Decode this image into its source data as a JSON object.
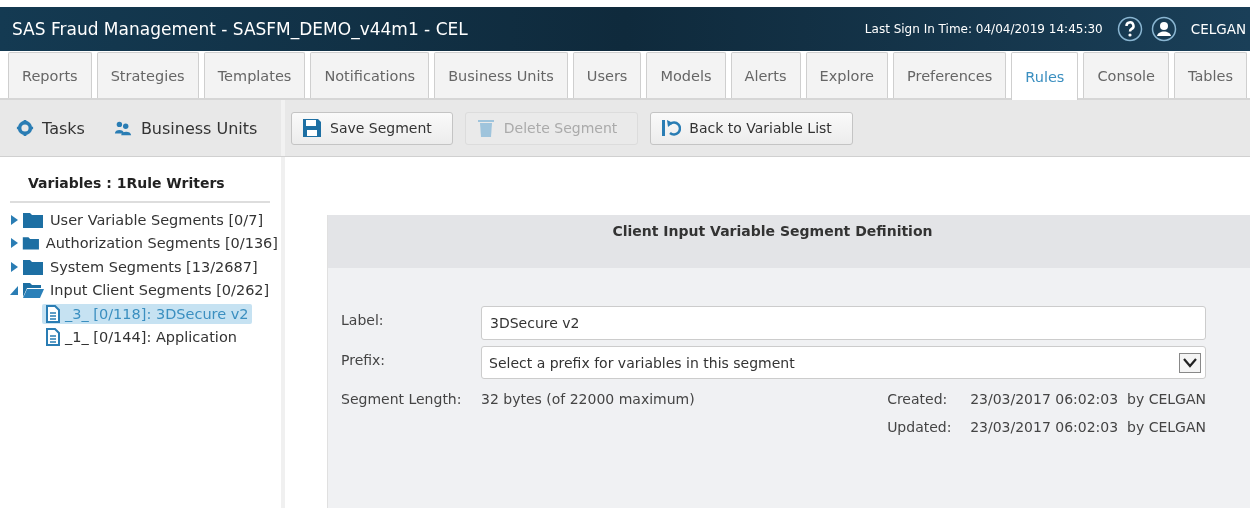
{
  "header": {
    "title": "SAS Fraud Management - SASFM_DEMO_v44m1 - CEL",
    "last_sign_in": "Last Sign In Time: 04/04/2019 14:45:30",
    "user": "CELGAN"
  },
  "tabs": [
    {
      "label": "Reports",
      "selected": false
    },
    {
      "label": "Strategies",
      "selected": false
    },
    {
      "label": "Templates",
      "selected": false
    },
    {
      "label": "Notifications",
      "selected": false
    },
    {
      "label": "Business Units",
      "selected": false
    },
    {
      "label": "Users",
      "selected": false
    },
    {
      "label": "Models",
      "selected": false
    },
    {
      "label": "Alerts",
      "selected": false
    },
    {
      "label": "Explore",
      "selected": false
    },
    {
      "label": "Preferences",
      "selected": false
    },
    {
      "label": "Rules",
      "selected": true
    },
    {
      "label": "Console",
      "selected": false
    },
    {
      "label": "Tables",
      "selected": false
    }
  ],
  "toolbar": {
    "left": [
      {
        "label": "Tasks",
        "kind": "tasks"
      },
      {
        "label": "Business Units",
        "kind": "units"
      }
    ],
    "buttons": [
      {
        "label": "Save Segment",
        "kind": "save",
        "disabled": false
      },
      {
        "label": "Delete Segment",
        "kind": "delete",
        "disabled": true
      },
      {
        "label": "Back to Variable List",
        "kind": "back",
        "disabled": false
      }
    ]
  },
  "sidebar": {
    "title": "Variables : 1Rule Writers",
    "tree": [
      {
        "label": "User Variable Segments [0/7]",
        "kind": "folder",
        "expanded": false,
        "selected": false
      },
      {
        "label": "Authorization Segments [0/136]",
        "kind": "folder",
        "expanded": false,
        "selected": false
      },
      {
        "label": "System Segments [13/2687]",
        "kind": "folder",
        "expanded": false,
        "selected": false
      },
      {
        "label": "Input Client Segments [0/262]",
        "kind": "folder",
        "expanded": true,
        "selected": false,
        "children": [
          {
            "label": "_3_ [0/118]: 3DSecure v2",
            "kind": "document",
            "selected": true
          },
          {
            "label": "_1_ [0/144]: Application",
            "kind": "document",
            "selected": false
          }
        ]
      }
    ]
  },
  "panel": {
    "title": "Client Input Variable Segment Definition",
    "label_field": {
      "label": "Label:",
      "value": "3DSecure v2"
    },
    "prefix_field": {
      "label": "Prefix:",
      "placeholder": "Select a prefix for variables in this segment"
    },
    "segment_length": {
      "label": "Segment Length:",
      "value": "32 bytes (of 22000 maximum)"
    },
    "created": {
      "label": "Created:",
      "value": "23/03/2017 06:02:03  by CELGAN"
    },
    "updated": {
      "label": "Updated:",
      "value": "23/03/2017 06:02:03  by CELGAN"
    }
  }
}
